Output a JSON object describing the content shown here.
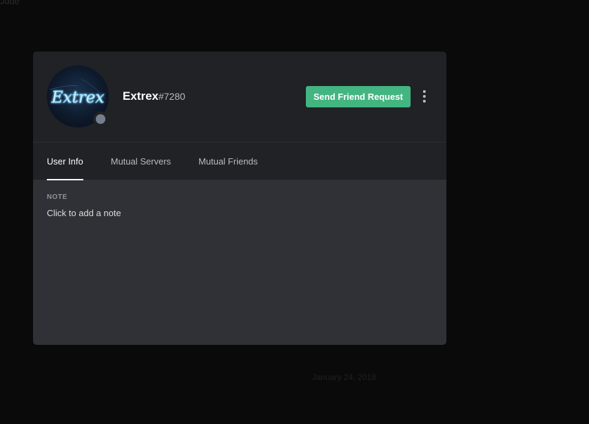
{
  "backdrop": {
    "top_text": "Jude",
    "date": "January 24, 2018"
  },
  "profile": {
    "username": "Extrex",
    "discriminator": "#7280",
    "avatar_text": "Extrex",
    "status": "offline",
    "status_color": "#747f8d"
  },
  "actions": {
    "send_friend_request": "Send Friend Request",
    "more_icon": "more-vertical-icon"
  },
  "tabs": [
    {
      "label": "User Info",
      "active": true
    },
    {
      "label": "Mutual Servers",
      "active": false
    },
    {
      "label": "Mutual Friends",
      "active": false
    }
  ],
  "note": {
    "title": "NOTE",
    "placeholder": "Click to add a note"
  },
  "colors": {
    "accent_green": "#43b581",
    "header_bg": "#202225",
    "body_bg": "#2f3136"
  }
}
